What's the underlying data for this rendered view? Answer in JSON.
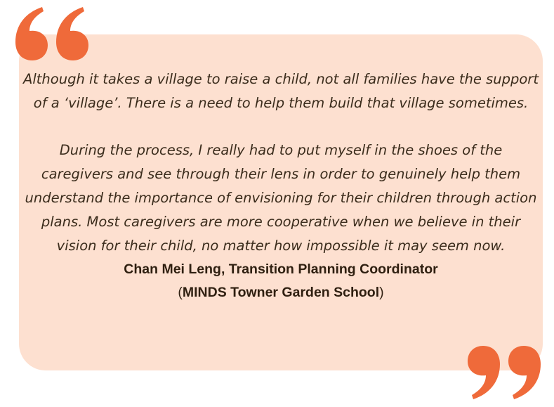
{
  "quote": {
    "paragraph_1": "Although it takes a village to raise a child, not all families have the support of a ‘village’. There is a need to help them build that village sometimes.",
    "paragraph_2": "During the process, I really had to put myself in the shoes of the caregivers and see through their lens in order to genuinely help them understand the importance of envisioning for their children through action plans. Most caregivers are more cooperative when we believe in their vision for their child, no matter how impossible it may seem now."
  },
  "attribution": {
    "name_role": "Chan Mei Leng, Transition Planning Coordinator",
    "paren_open": "(",
    "organization": "MINDS Towner Garden School",
    "paren_close": ")"
  },
  "colors": {
    "card_background": "#fde0d0",
    "quote_mark": "#ef6a3a",
    "text": "#3b2c1c"
  },
  "icons": {
    "open": "open-quote-icon",
    "close": "close-quote-icon"
  }
}
